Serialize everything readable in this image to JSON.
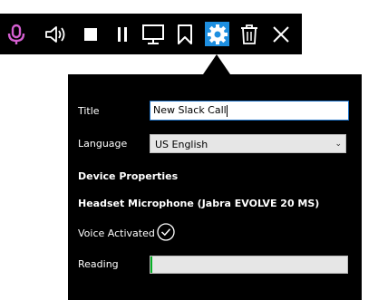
{
  "toolbar": {
    "buttons": [
      {
        "name": "microphone-icon",
        "active": false
      },
      {
        "name": "speaker-icon",
        "active": false
      },
      {
        "name": "stop-icon",
        "active": false
      },
      {
        "name": "pause-icon",
        "active": false
      },
      {
        "name": "monitor-icon",
        "active": false
      },
      {
        "name": "bookmark-icon",
        "active": false
      },
      {
        "name": "settings-icon",
        "active": true
      },
      {
        "name": "trash-icon",
        "active": false
      },
      {
        "name": "close-icon",
        "active": false
      }
    ],
    "mic_color": "#d45fd0",
    "active_color": "#1e8fe0"
  },
  "settings": {
    "title_label": "Title",
    "title_value": "New Slack Call",
    "language_label": "Language",
    "language_value": "US English",
    "device_heading": "Device Properties",
    "device_name": "Headset Microphone (Jabra EVOLVE 20 MS)",
    "voice_label": "Voice Activated",
    "voice_activated": true,
    "reading_label": "Reading",
    "reading_level": 0.01
  }
}
